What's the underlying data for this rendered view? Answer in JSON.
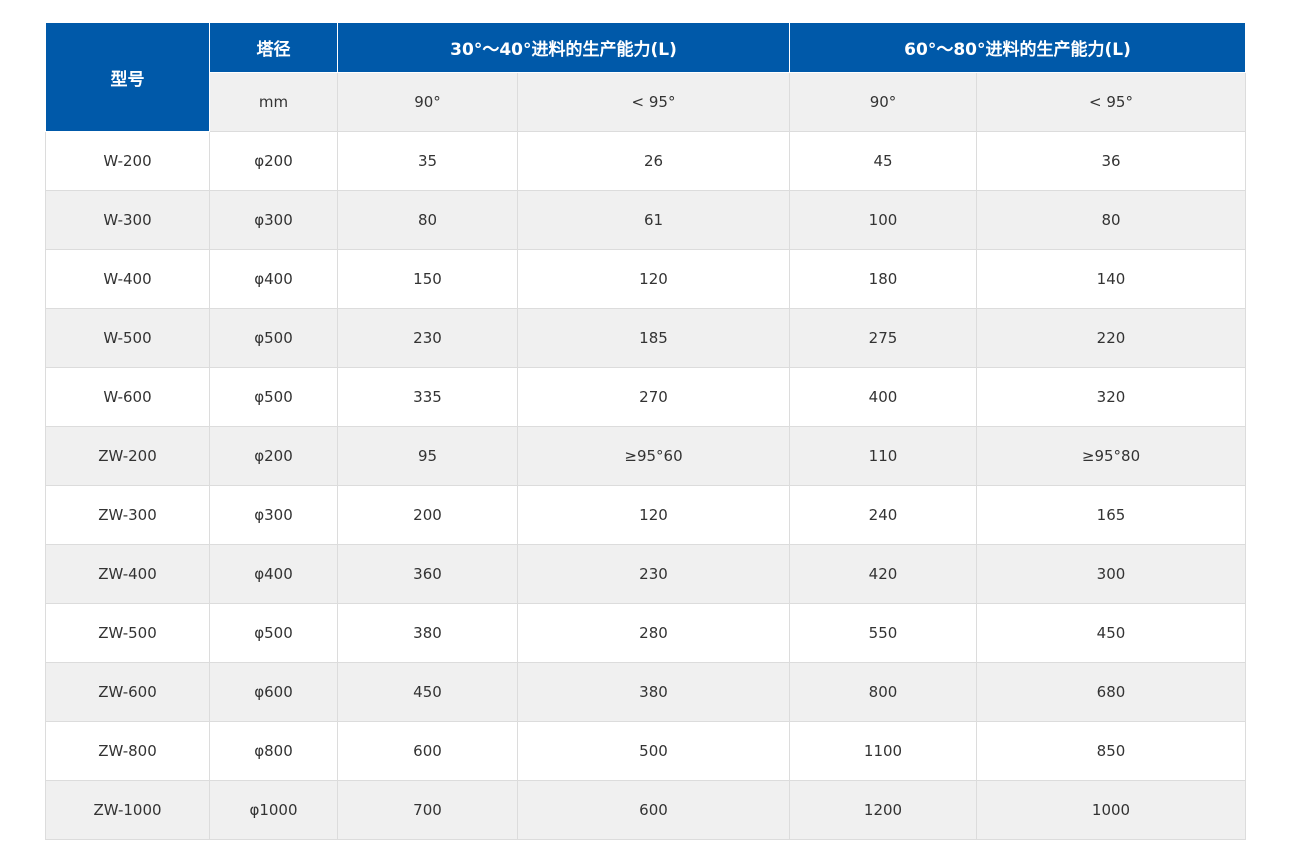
{
  "header": {
    "model": "型号",
    "diameter": "塔径",
    "group_1": "30°～40°进料的生产能力(L)",
    "group_2": "60°～80°进料的生产能力(L)"
  },
  "subheader": {
    "diameter_unit": "mm",
    "g1_a": "90°",
    "g1_b": "< 95°",
    "g2_a": "90°",
    "g2_b": "< 95°"
  },
  "rows": [
    [
      "W-200",
      "φ200",
      "35",
      "26",
      "45",
      "36"
    ],
    [
      "W-300",
      "φ300",
      "80",
      "61",
      "100",
      "80"
    ],
    [
      "W-400",
      "φ400",
      "150",
      "120",
      "180",
      "140"
    ],
    [
      "W-500",
      "φ500",
      "230",
      "185",
      "275",
      "220"
    ],
    [
      "W-600",
      "φ500",
      "335",
      "270",
      "400",
      "320"
    ],
    [
      "ZW-200",
      "φ200",
      "95",
      "≥95°60",
      "110",
      "≥95°80"
    ],
    [
      "ZW-300",
      "φ300",
      "200",
      "120",
      "240",
      "165"
    ],
    [
      "ZW-400",
      "φ400",
      "360",
      "230",
      "420",
      "300"
    ],
    [
      "ZW-500",
      "φ500",
      "380",
      "280",
      "550",
      "450"
    ],
    [
      "ZW-600",
      "φ600",
      "450",
      "380",
      "800",
      "680"
    ],
    [
      "ZW-800",
      "φ800",
      "600",
      "500",
      "1100",
      "850"
    ],
    [
      "ZW-1000",
      "φ1000",
      "700",
      "600",
      "1200",
      "1000"
    ]
  ],
  "colors": {
    "header_bg": "#0059a9",
    "stripe_bg": "#f0f0f0"
  }
}
